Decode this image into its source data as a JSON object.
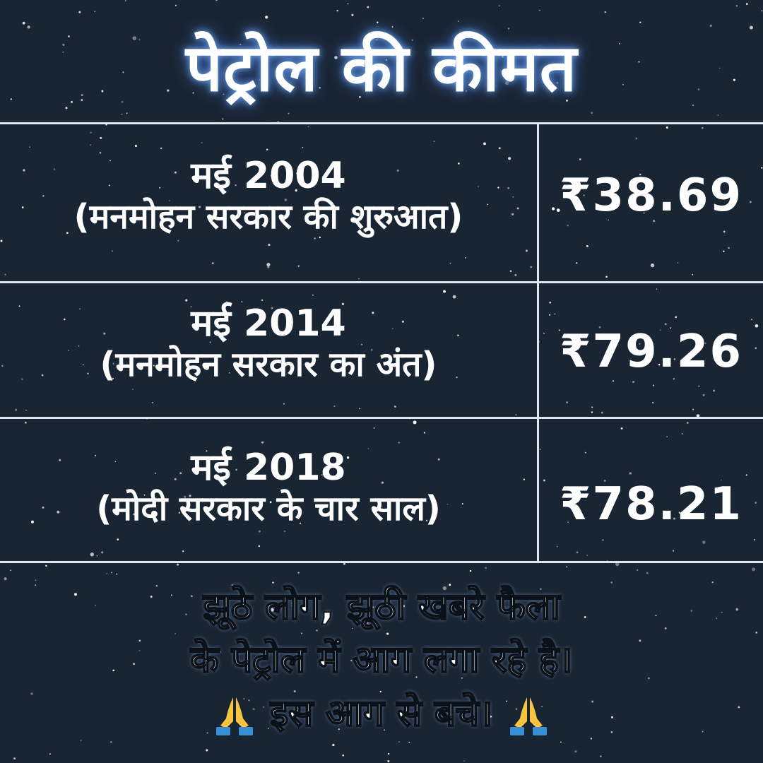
{
  "title": "पेट्रोल की कीमत",
  "rows": [
    {
      "date": "मई 2004",
      "period": "(मनमोहन सरकार की शुरुआत)",
      "price": "₹38.69"
    },
    {
      "date": "मई 2014",
      "period": "(मनमोहन सरकार का अंत)",
      "price": "₹79.26"
    },
    {
      "date": "मई 2018",
      "period": "(मोदी सरकार के चार साल)",
      "price": "₹78.21"
    }
  ],
  "footer": {
    "line1": "झूठे लोग, झूठी खबरे फैला",
    "line2": "के पेट्रोल में आग लगा रहे है।",
    "line3": "इस आग से बचे।",
    "icon": "folded-hands-icon"
  },
  "colors": {
    "background": "#1a2533",
    "text": "#ffffff",
    "lines": "#dfe6ee",
    "glow": "#78b4ff",
    "icon_yellow": "#f5c542",
    "icon_blue": "#3a8fd6"
  }
}
